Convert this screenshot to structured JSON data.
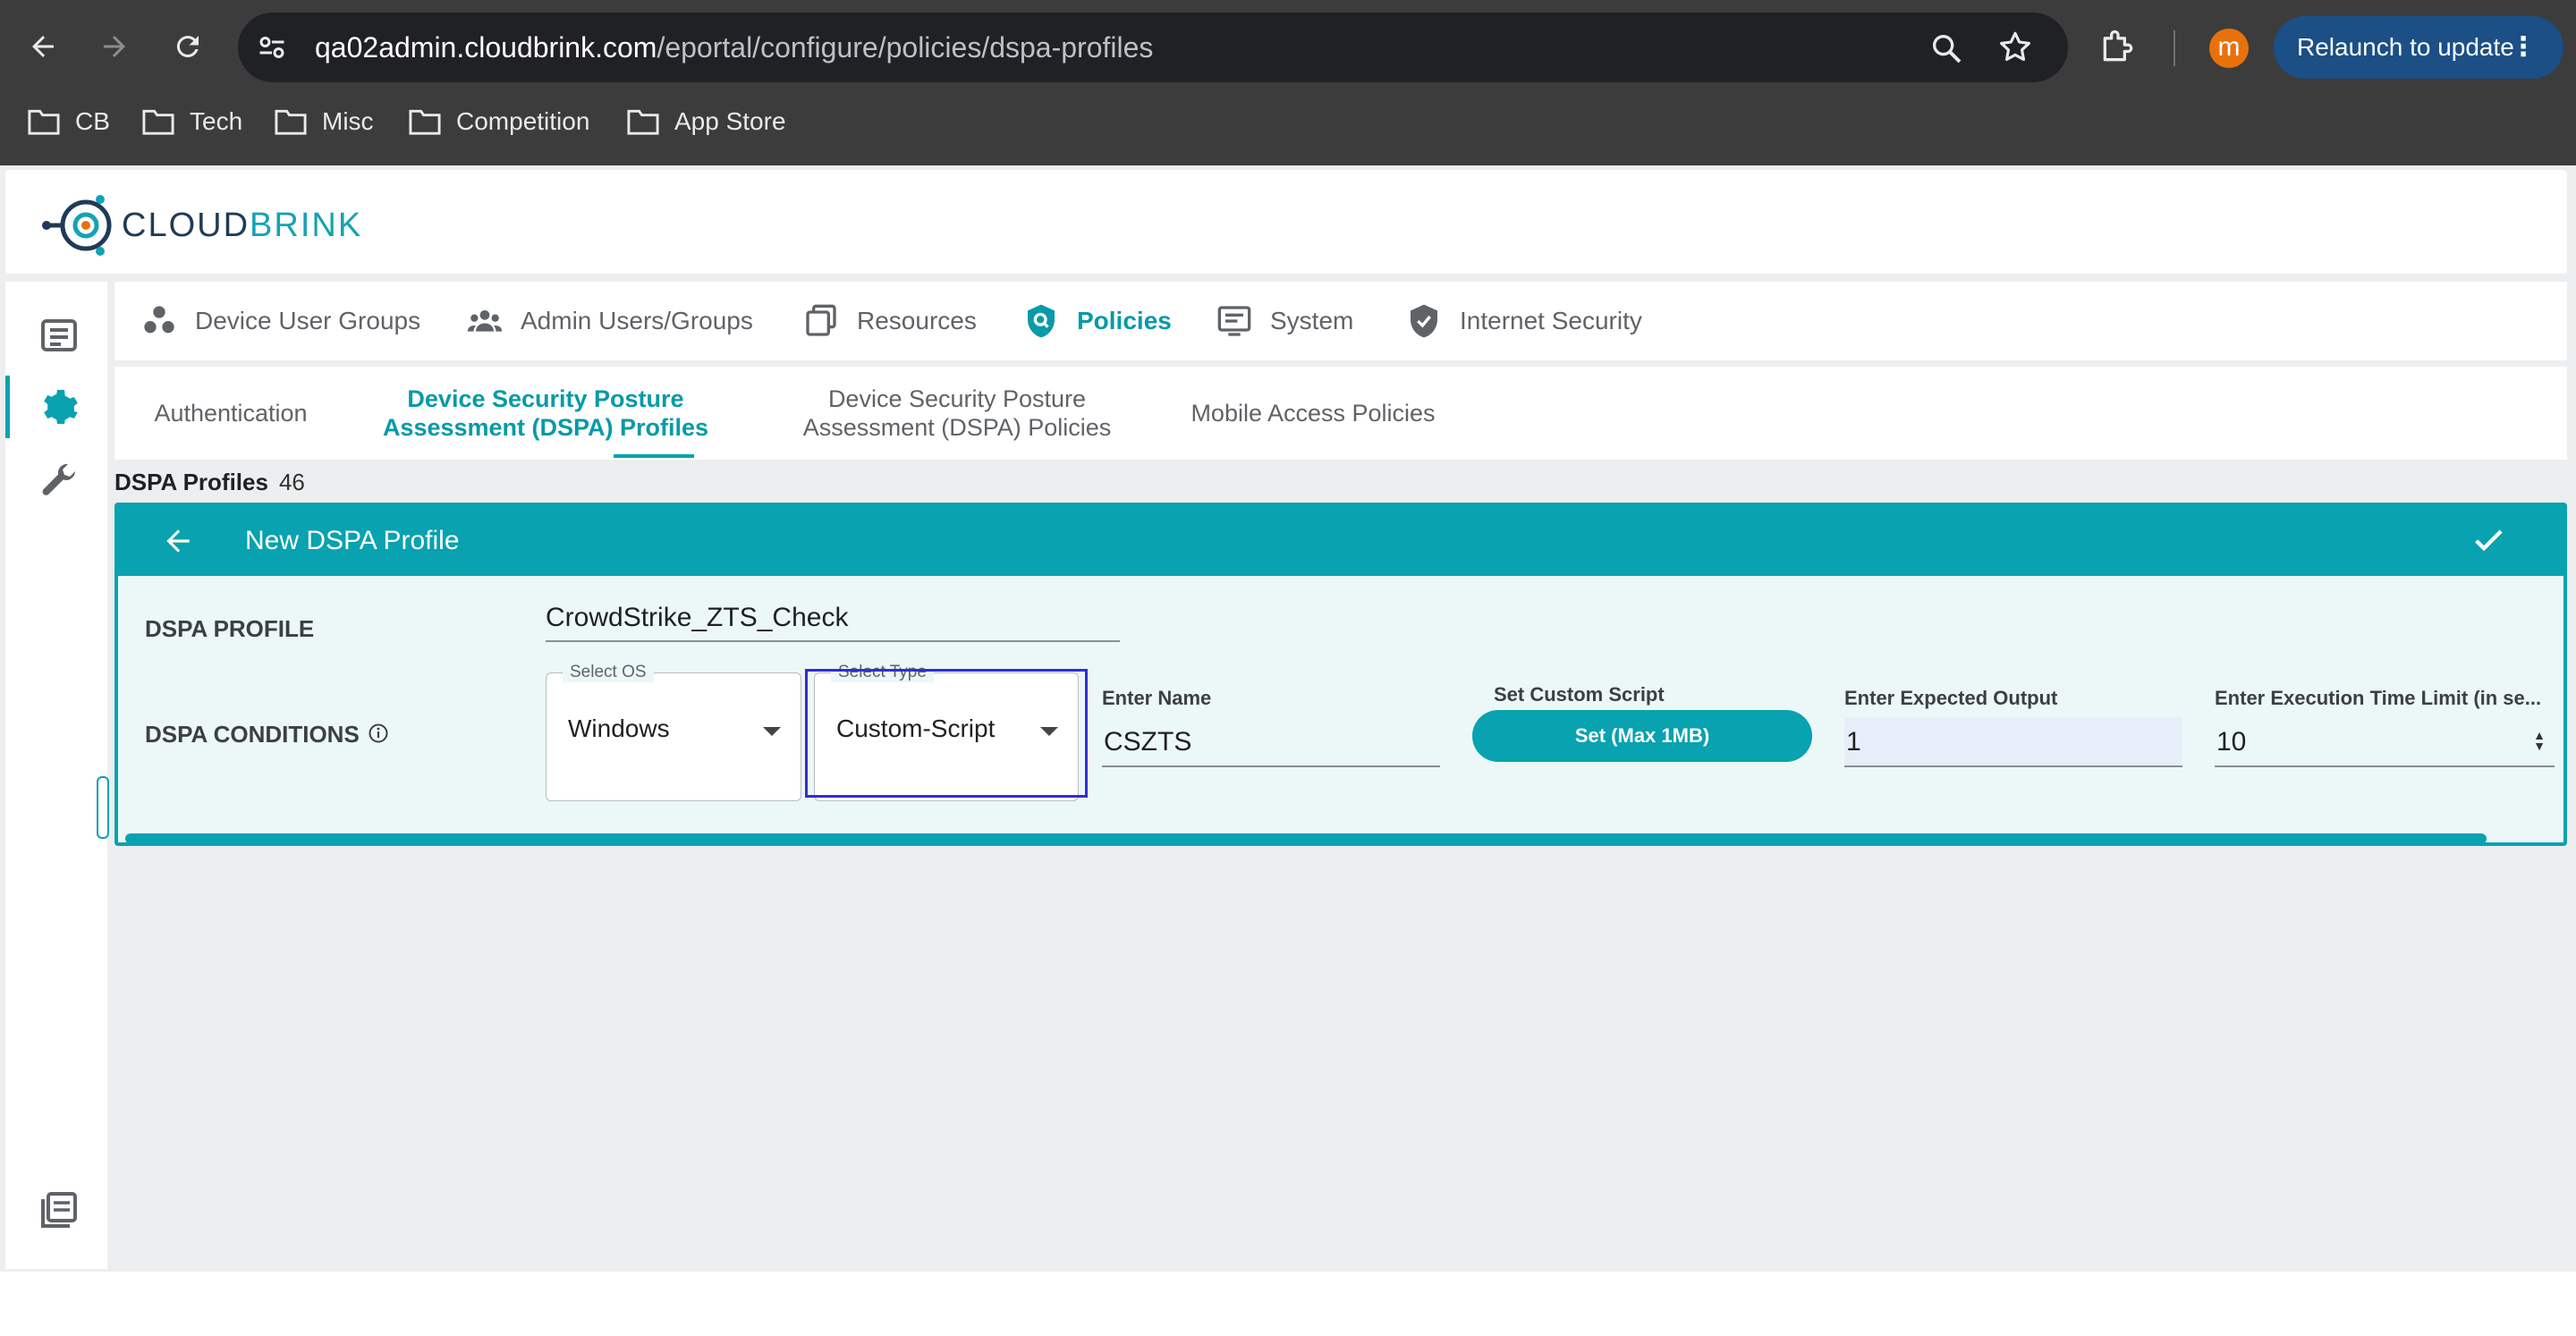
{
  "browser": {
    "url_host": "qa02admin.cloudbrink.com",
    "url_path": "/eportal/configure/policies/dspa-profiles",
    "profile_initial": "m",
    "relaunch_label": "Relaunch to update",
    "bookmarks": [
      {
        "label": "CB"
      },
      {
        "label": "Tech"
      },
      {
        "label": "Misc"
      },
      {
        "label": "Competition"
      },
      {
        "label": "App Store"
      }
    ]
  },
  "logo": {
    "part1": "CLOUD",
    "part2": "BRINK"
  },
  "top_tabs": [
    {
      "label": "Device User Groups",
      "icon": "groups-icon"
    },
    {
      "label": "Admin Users/Groups",
      "icon": "admin-users-icon"
    },
    {
      "label": "Resources",
      "icon": "resources-icon"
    },
    {
      "label": "Policies",
      "icon": "policies-shield-icon",
      "active": true
    },
    {
      "label": "System",
      "icon": "system-icon"
    },
    {
      "label": "Internet Security",
      "icon": "internet-security-shield-icon"
    }
  ],
  "sub_tabs": [
    {
      "line1": "Authentication",
      "line2": ""
    },
    {
      "line1": "Device Security Posture",
      "line2": "Assessment (DSPA) Profiles",
      "active": true
    },
    {
      "line1": "Device Security Posture",
      "line2": "Assessment (DSPA) Policies"
    },
    {
      "line1": "Mobile Access Policies",
      "line2": ""
    }
  ],
  "profiles_count": {
    "label": "DSPA Profiles",
    "count": "46"
  },
  "card": {
    "title": "New DSPA Profile",
    "profile_label": "DSPA PROFILE",
    "profile_value": "CrowdStrike_ZTS_Check",
    "conditions_label": "DSPA CONDITIONS",
    "select_os": {
      "legend": "Select OS",
      "value": "Windows"
    },
    "select_type": {
      "legend": "Select Type",
      "value": "Custom-Script"
    },
    "enter_name": {
      "label": "Enter Name",
      "value": "CSZTS"
    },
    "custom_script": {
      "label": "Set Custom Script",
      "button": "Set (Max 1MB)"
    },
    "expected_output": {
      "label": "Enter Expected Output",
      "value": "1"
    },
    "exec_time": {
      "label": "Enter Execution Time Limit (in se...",
      "value": "10"
    }
  },
  "colors": {
    "accent": "#08a2b0",
    "focus_outline": "#2f2fd0",
    "chrome_bg": "#3c3c3c"
  }
}
